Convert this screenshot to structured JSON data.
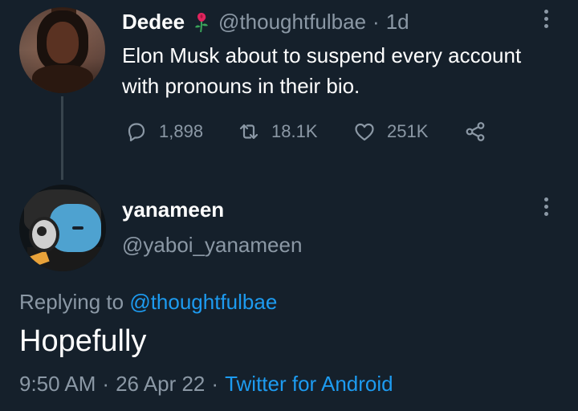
{
  "parent_tweet": {
    "display_name": "Dedee",
    "badge_icon": "rose-icon",
    "handle": "@thoughtfulbae",
    "separator": "·",
    "age": "1d",
    "text": "Elon Musk about to suspend every account with pronouns in their bio.",
    "actions": {
      "replies": "1,898",
      "retweets": "18.1K",
      "likes": "251K"
    }
  },
  "reply_tweet": {
    "display_name": "yanameen",
    "handle": "@yaboi_yanameen",
    "replying_prefix": "Replying to",
    "replying_to": "@thoughtfulbae",
    "text": "Hopefully",
    "time": "9:50 AM",
    "separator": "·",
    "date": "26 Apr 22",
    "source": "Twitter for Android"
  },
  "colors": {
    "background": "#15202b",
    "muted_text": "#8b98a5",
    "link": "#1d9bf0",
    "primary_text": "#ffffff"
  }
}
